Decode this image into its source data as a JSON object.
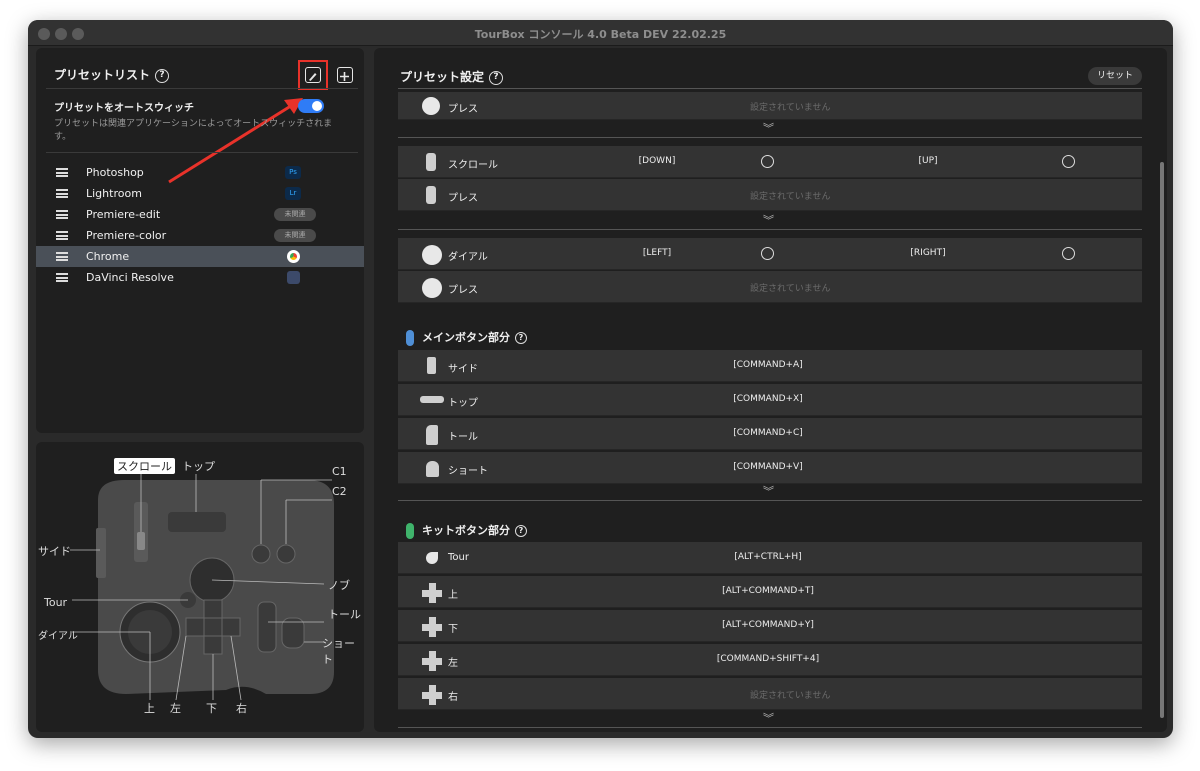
{
  "window": {
    "title": "TourBox コンソール 4.0 Beta DEV 22.02.25"
  },
  "preset_list": {
    "title": "プリセットリスト",
    "help": "?",
    "auto_switch_label": "プリセットをオートスウィッチ",
    "auto_switch_desc": "プリセットは関連アプリケーションによってオートスウィッチされます。",
    "auto_switch_on": true,
    "items": [
      {
        "name": "Photoshop",
        "badge": "Ps"
      },
      {
        "name": "Lightroom",
        "badge": "Lr"
      },
      {
        "name": "Premiere-edit",
        "badge": "未関連"
      },
      {
        "name": "Premiere-color",
        "badge": "未関連"
      },
      {
        "name": "Chrome",
        "badge": "chrome-icon",
        "selected": true
      },
      {
        "name": "DaVinci Resolve",
        "badge": "davinci-icon"
      }
    ]
  },
  "device_labels": {
    "scroll": "スクロール",
    "top": "トップ",
    "c1": "C1",
    "c2": "C2",
    "side": "サイド",
    "knob": "ノブ",
    "tour": "Tour",
    "tall": "トール",
    "dial": "ダイアル",
    "short": "ショート",
    "up": "上",
    "left": "左",
    "down": "下",
    "right": "右"
  },
  "preset_settings": {
    "title": "プリセット設定",
    "reset": "リセット",
    "not_set": "設定されていません",
    "knob_press": "プレス",
    "scroll": {
      "label": "スクロール",
      "down": "[DOWN]",
      "up": "[UP]",
      "press": "プレス"
    },
    "dial": {
      "label": "ダイアル",
      "left": "[LEFT]",
      "right": "[RIGHT]",
      "press": "プレス"
    },
    "main_section": "メインボタン部分",
    "main": [
      {
        "label": "サイド",
        "value": "[COMMAND+A]"
      },
      {
        "label": "トップ",
        "value": "[COMMAND+X]"
      },
      {
        "label": "トール",
        "value": "[COMMAND+C]"
      },
      {
        "label": "ショート",
        "value": "[COMMAND+V]"
      }
    ],
    "kit_section": "キットボタン部分",
    "kit": [
      {
        "label": "Tour",
        "value": "[ALT+CTRL+H]"
      },
      {
        "label": "上",
        "value": "[ALT+COMMAND+T]"
      },
      {
        "label": "下",
        "value": "[ALT+COMMAND+Y]"
      },
      {
        "label": "左",
        "value": "[COMMAND+SHIFT+4]"
      },
      {
        "label": "右",
        "value": ""
      }
    ],
    "colors": {
      "main": "#4f8fd6",
      "kit": "#3fb36b",
      "accent": "#2f7cf6",
      "highlight": "#e8322a"
    }
  }
}
